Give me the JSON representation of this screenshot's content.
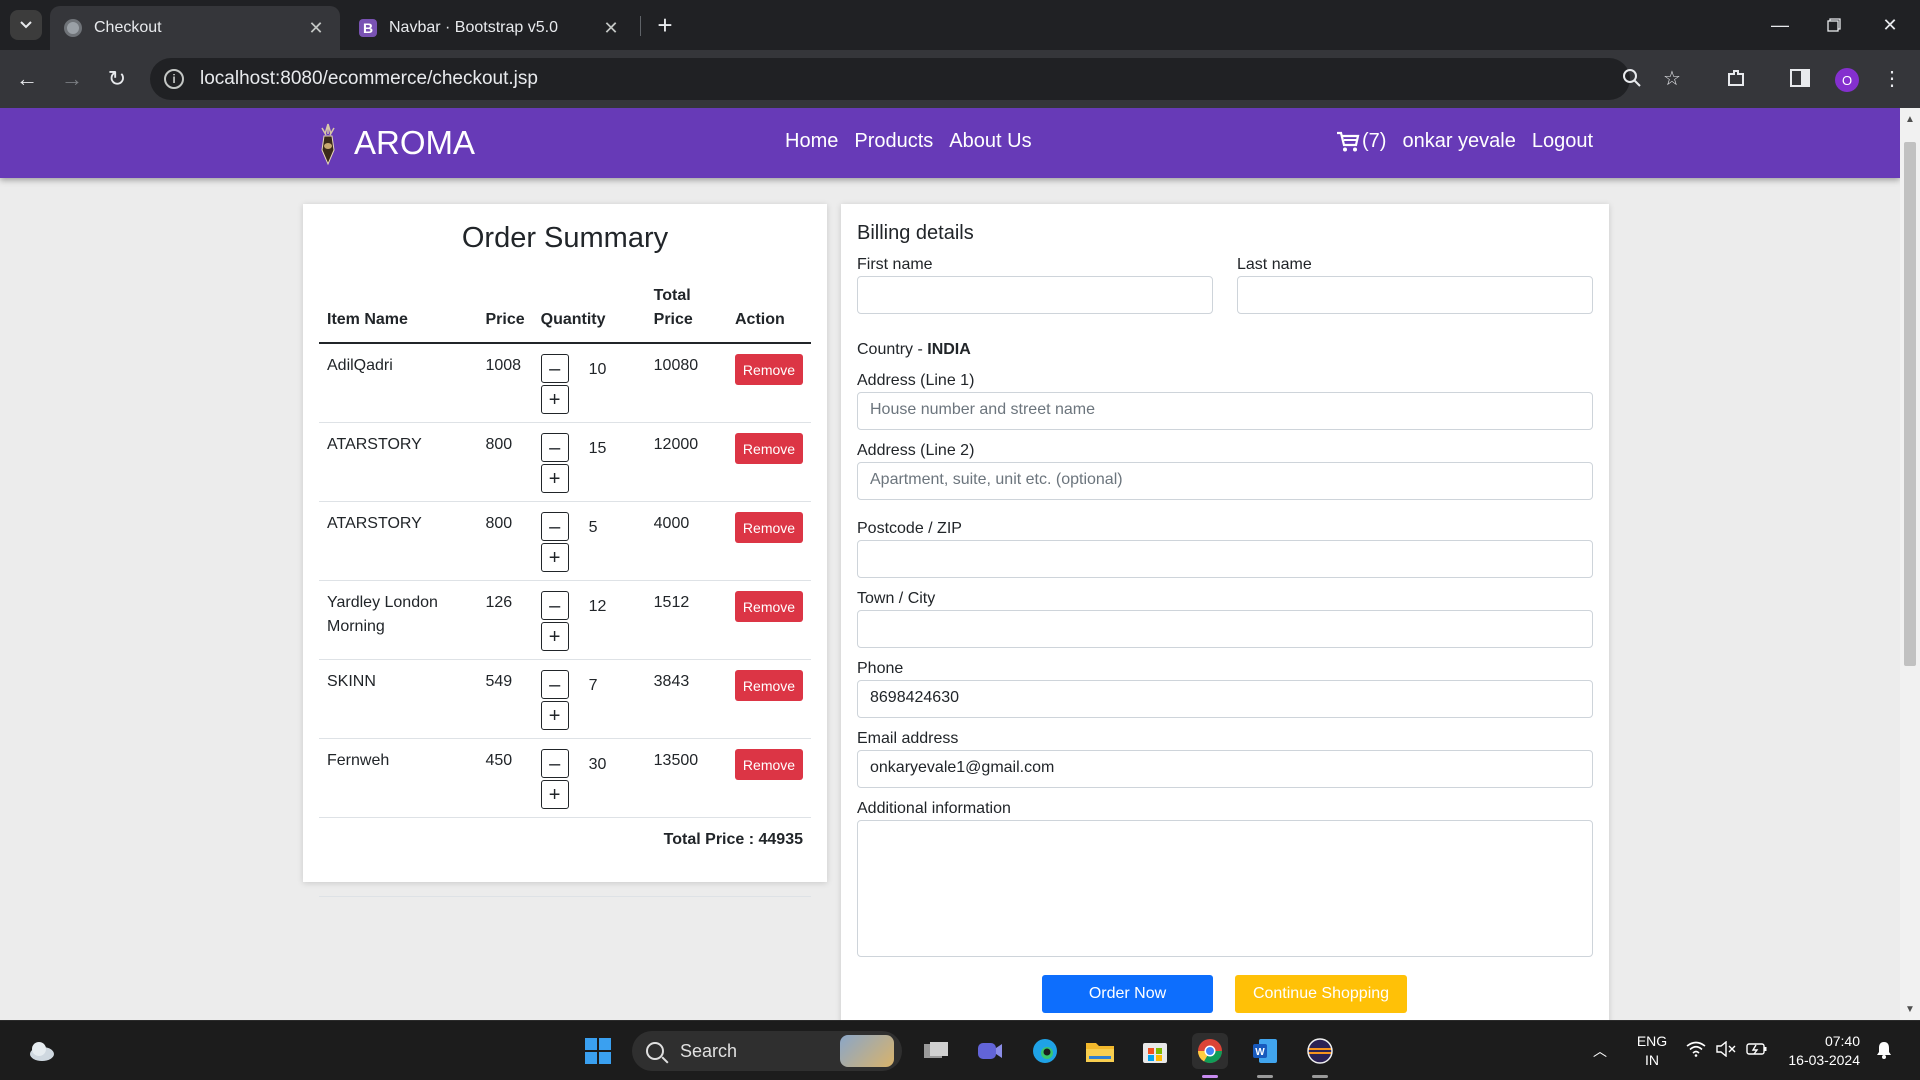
{
  "browser": {
    "tabs": [
      {
        "title": "Checkout",
        "active": true
      },
      {
        "title": "Navbar · Bootstrap v5.0",
        "active": false,
        "favicon_letter": "B"
      }
    ],
    "url": "localhost:8080/ecommerce/checkout.jsp",
    "profile_initial": "O"
  },
  "navbar": {
    "brand": "AROMA",
    "links": [
      "Home",
      "Products",
      "About Us"
    ],
    "cart_count": "(7)",
    "user": "onkar yevale",
    "logout": "Logout",
    "bg_color": "#673ab7"
  },
  "summary": {
    "title": "Order Summary",
    "headers": {
      "item": "Item Name",
      "price": "Price",
      "quantity": "Quantity",
      "total": "Total Price",
      "action": "Action"
    },
    "items": [
      {
        "name": "AdilQadri",
        "price": "1008",
        "qty": "10",
        "total": "10080"
      },
      {
        "name": "ATARSTORY",
        "price": "800",
        "qty": "15",
        "total": "12000"
      },
      {
        "name": "ATARSTORY",
        "price": "800",
        "qty": "5",
        "total": "4000"
      },
      {
        "name": "Yardley London Morning",
        "price": "126",
        "qty": "12",
        "total": "1512"
      },
      {
        "name": "SKINN",
        "price": "549",
        "qty": "7",
        "total": "3843"
      },
      {
        "name": "Fernweh",
        "price": "450",
        "qty": "30",
        "total": "13500"
      }
    ],
    "minus_label": "–",
    "plus_label": "+",
    "remove_label": "Remove",
    "grand_total": "Total Price : 44935"
  },
  "billing": {
    "title": "Billing details",
    "first_name_label": "First name",
    "last_name_label": "Last name",
    "country_label": "Country - ",
    "country_value": "INDIA",
    "address1_label": "Address (Line 1)",
    "address1_placeholder": "House number and street name",
    "address2_label": "Address (Line 2)",
    "address2_placeholder": "Apartment, suite, unit etc. (optional)",
    "postcode_label": "Postcode / ZIP",
    "town_label": "Town / City",
    "phone_label": "Phone",
    "phone_value": "8698424630",
    "email_label": "Email address",
    "email_value": "onkaryevale1@gmail.com",
    "additional_label": "Additional information",
    "order_button": "Order Now",
    "continue_button": "Continue Shopping"
  },
  "taskbar": {
    "search": "Search",
    "lang_line1": "ENG",
    "lang_line2": "IN",
    "time": "07:40",
    "date": "16-03-2024"
  }
}
